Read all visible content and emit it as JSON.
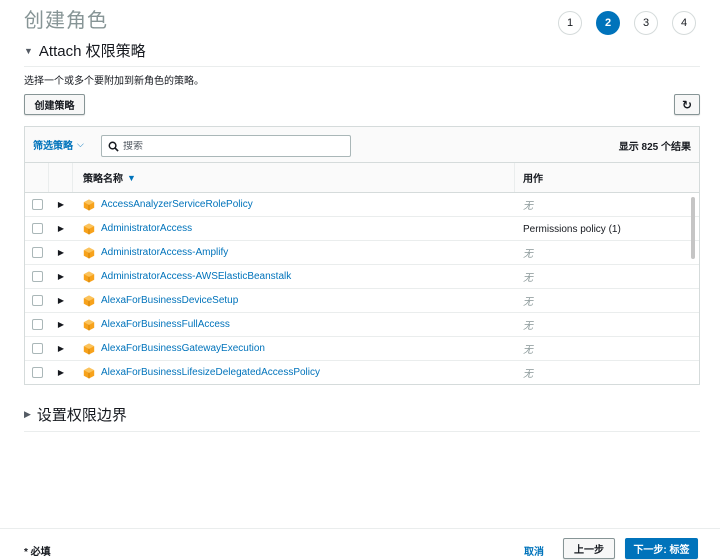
{
  "page": {
    "title": "创建角色"
  },
  "steps": [
    "1",
    "2",
    "3",
    "4"
  ],
  "active_step": 2,
  "attach_section": {
    "title": "Attach 权限策略",
    "description": "选择一个或多个要附加到新角色的策略。",
    "create_policy_label": "创建策略",
    "refresh_icon": "↻"
  },
  "table": {
    "filter_label": "筛选策略",
    "search_placeholder": "搜索",
    "result_count": "显示 825 个结果",
    "columns": {
      "name": "策略名称",
      "usage": "用作"
    },
    "rows": [
      {
        "name": "AccessAnalyzerServiceRolePolicy",
        "usage": "无",
        "none": true
      },
      {
        "name": "AdministratorAccess",
        "usage": "Permissions policy (1)",
        "none": false
      },
      {
        "name": "AdministratorAccess-Amplify",
        "usage": "无",
        "none": true
      },
      {
        "name": "AdministratorAccess-AWSElasticBeanstalk",
        "usage": "无",
        "none": true
      },
      {
        "name": "AlexaForBusinessDeviceSetup",
        "usage": "无",
        "none": true
      },
      {
        "name": "AlexaForBusinessFullAccess",
        "usage": "无",
        "none": true
      },
      {
        "name": "AlexaForBusinessGatewayExecution",
        "usage": "无",
        "none": true
      },
      {
        "name": "AlexaForBusinessLifesizeDelegatedAccessPolicy",
        "usage": "无",
        "none": true
      }
    ]
  },
  "boundary_section": {
    "title": "设置权限边界"
  },
  "footer": {
    "required_label": "* 必填",
    "cancel_label": "取消",
    "prev_label": "上一步",
    "next_label": "下一步: 标签"
  },
  "colors": {
    "accent": "#0073bb",
    "policy_icon": "#f7a21b"
  }
}
